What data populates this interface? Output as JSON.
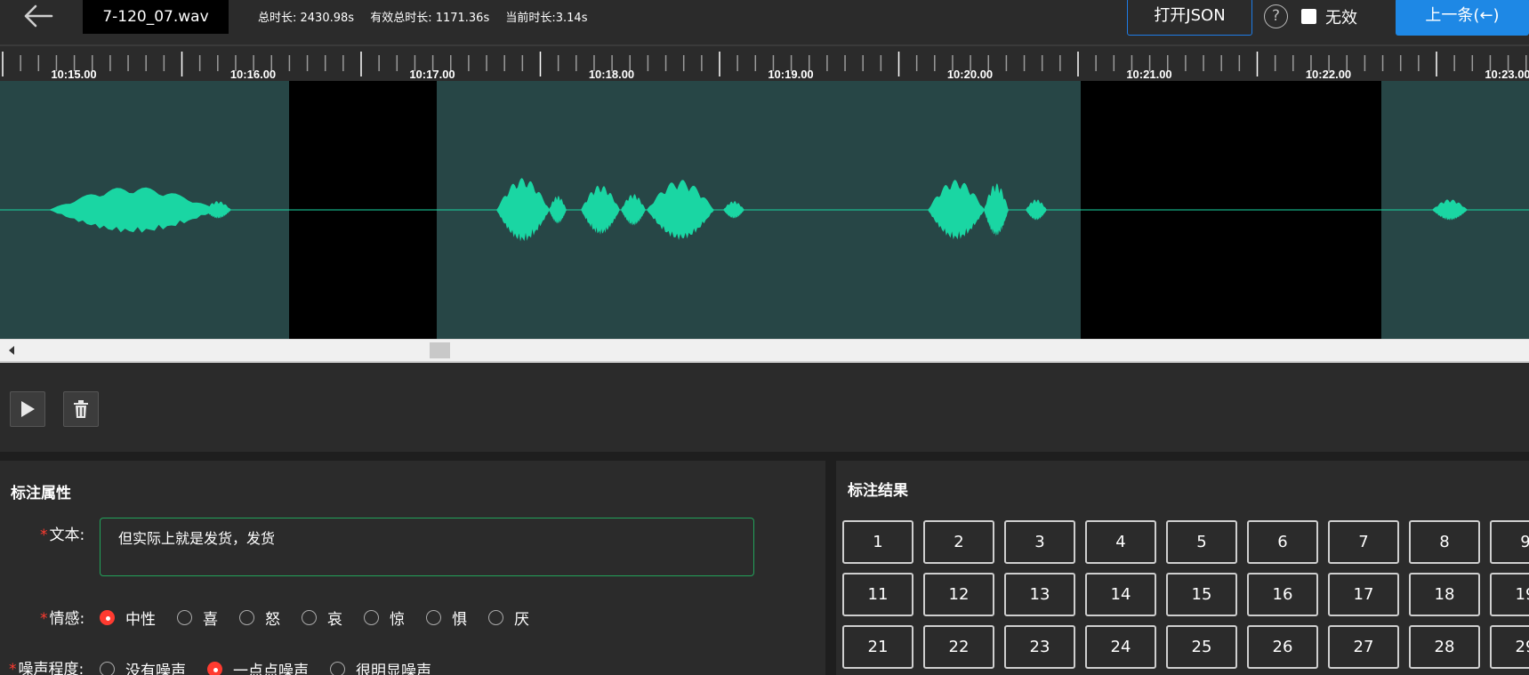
{
  "header": {
    "filename": "7-120_07.wav",
    "total_duration": "总时长: 2430.98s",
    "valid_total_duration": "有效总时长: 1171.36s",
    "current_duration": "当前时长:3.14s",
    "open_json_label": "打开JSON",
    "help_label": "?",
    "invalid_label": "无效",
    "invalid_checked": false,
    "prev_label": "上一条(←)"
  },
  "timeline": {
    "labels": [
      "10:15.00",
      "10:16.00",
      "10:17.00",
      "10:18.00",
      "10:19.00",
      "10:20.00",
      "10:21.00",
      "10:22.00",
      "10:23.00"
    ]
  },
  "waveform": {
    "background_color": "#274646",
    "wave_color": "#1ad6a3",
    "gap_color": "#000000"
  },
  "controls": {
    "play_icon": "play-icon",
    "delete_icon": "trash-icon"
  },
  "attributes": {
    "title": "标注属性",
    "text_label": "文本:",
    "text_value": "但实际上就是发货，发货",
    "emotion_label": "情感:",
    "emotions": [
      {
        "label": "中性",
        "checked": true
      },
      {
        "label": "喜",
        "checked": false
      },
      {
        "label": "怒",
        "checked": false
      },
      {
        "label": "哀",
        "checked": false
      },
      {
        "label": "惊",
        "checked": false
      },
      {
        "label": "惧",
        "checked": false
      },
      {
        "label": "厌",
        "checked": false
      }
    ],
    "noise_label": "噪声程度:",
    "noise_levels": [
      {
        "label": "没有噪声",
        "checked": false
      },
      {
        "label": "一点点噪声",
        "checked": true
      },
      {
        "label": "很明显噪声",
        "checked": false
      }
    ]
  },
  "results": {
    "title": "标注结果",
    "rows": [
      [
        "1",
        "2",
        "3",
        "4",
        "5",
        "6",
        "7",
        "8",
        "9"
      ],
      [
        "11",
        "12",
        "13",
        "14",
        "15",
        "16",
        "17",
        "18",
        "19"
      ],
      [
        "21",
        "22",
        "23",
        "24",
        "25",
        "26",
        "27",
        "28",
        "29"
      ]
    ]
  }
}
